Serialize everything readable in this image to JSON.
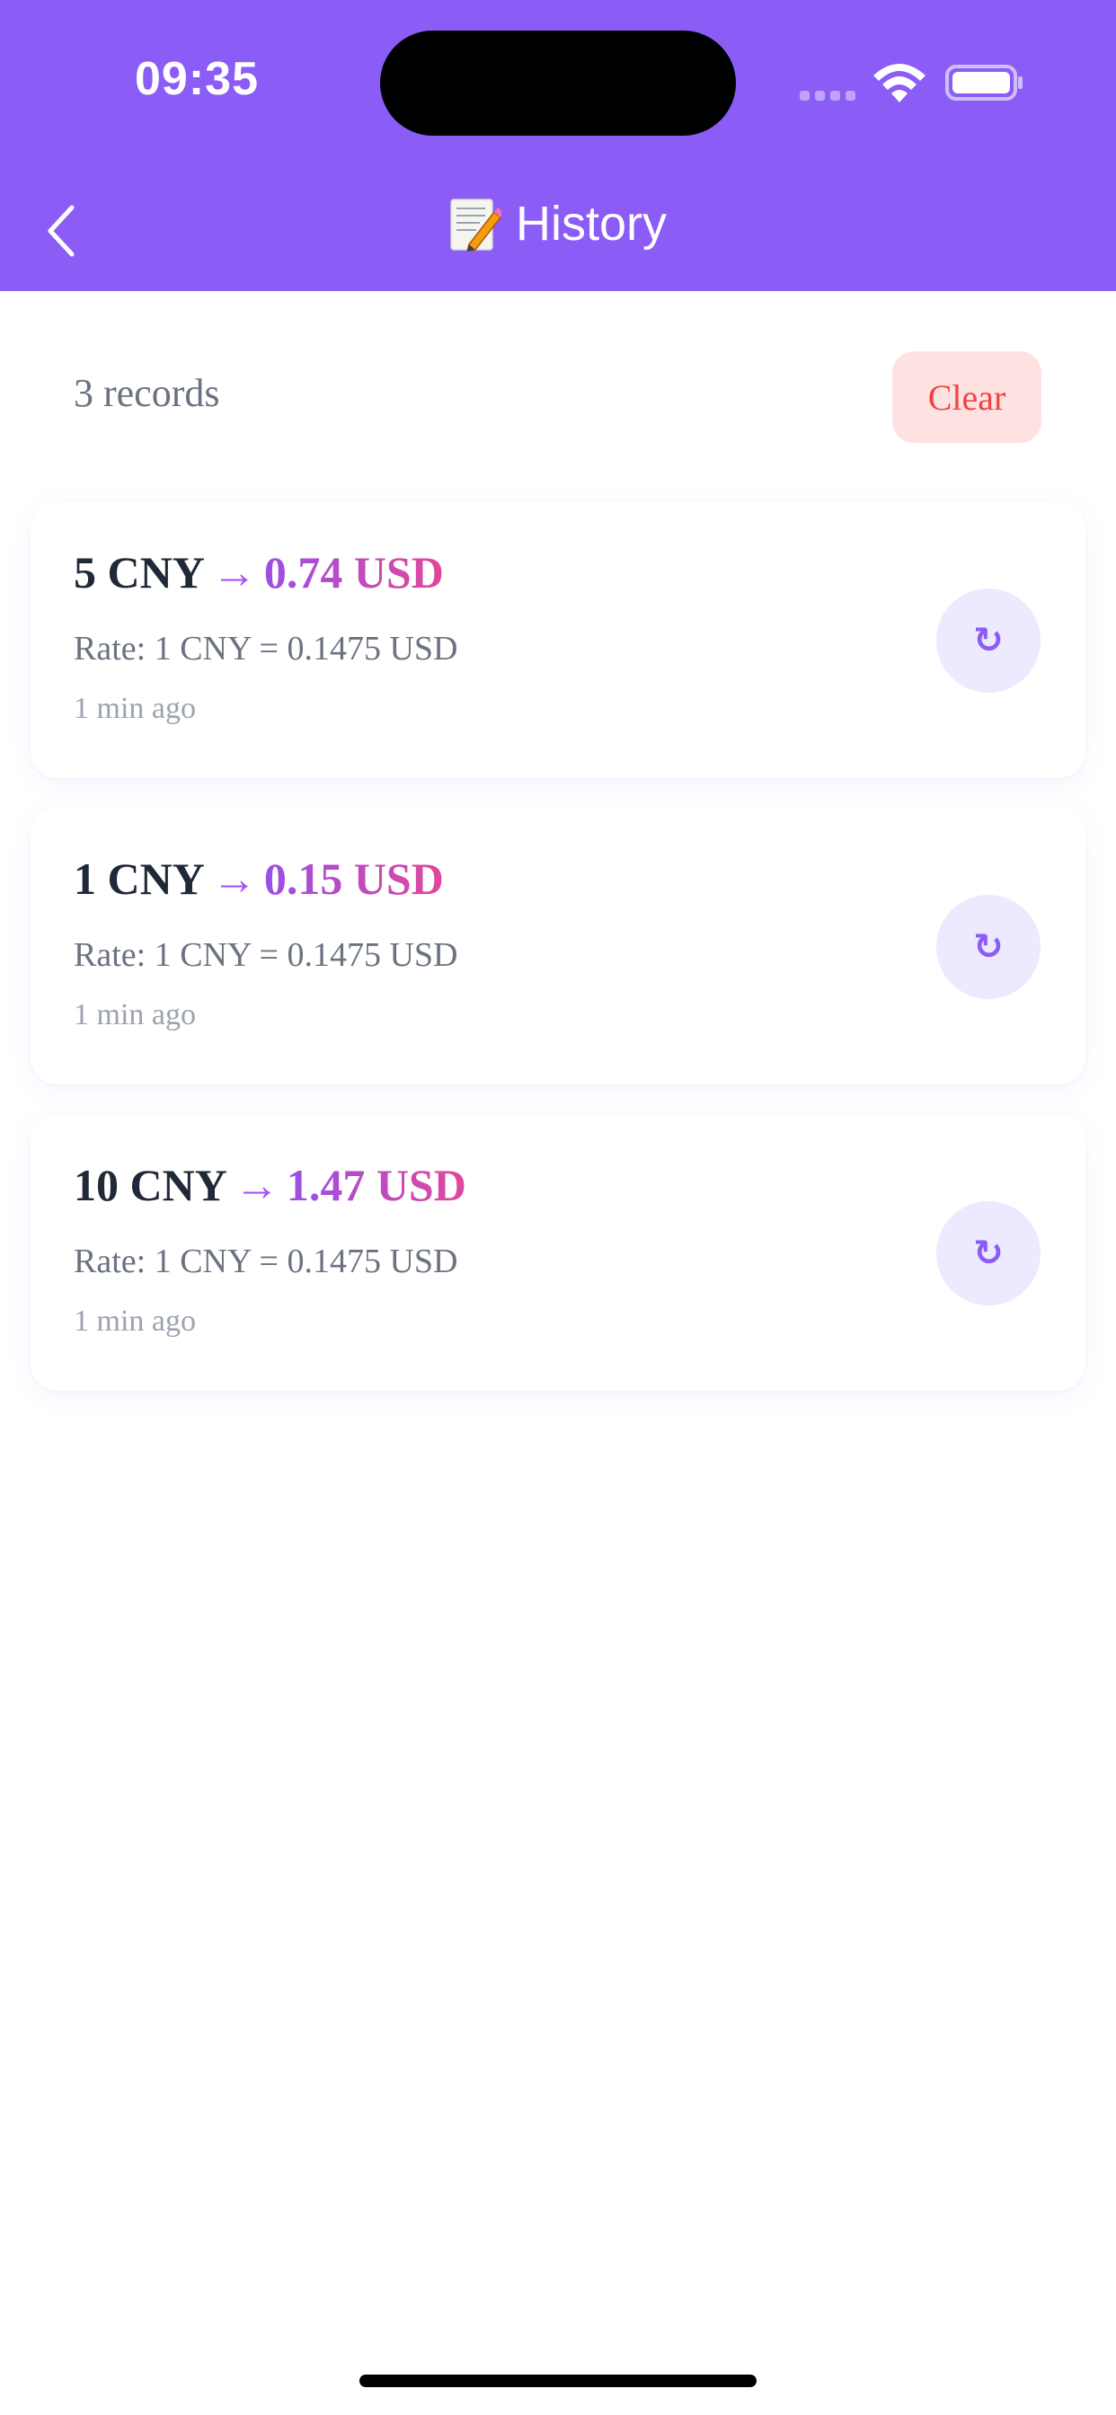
{
  "status_bar": {
    "time": "09:35",
    "icons": [
      "cellular-signal-icon",
      "wifi-icon",
      "battery-icon"
    ]
  },
  "nav": {
    "back_icon": "chevron-left-icon",
    "title_icon": "memo-icon",
    "title": "History"
  },
  "summary": {
    "records_label": "3 records",
    "clear_label": "Clear"
  },
  "records": [
    {
      "from": "5 CNY",
      "arrow": "→",
      "to": "0.74 USD",
      "rate": "Rate: 1 CNY = 0.1475 USD",
      "time": "1 min ago",
      "action_icon": "↻"
    },
    {
      "from": "1 CNY",
      "arrow": "→",
      "to": "0.15 USD",
      "rate": "Rate: 1 CNY = 0.1475 USD",
      "time": "1 min ago",
      "action_icon": "↻"
    },
    {
      "from": "10 CNY",
      "arrow": "→",
      "to": "1.47 USD",
      "rate": "Rate: 1 CNY = 0.1475 USD",
      "time": "1 min ago",
      "action_icon": "↻"
    }
  ],
  "colors": {
    "header": "#8b5cf6",
    "clear_bg": "#fee2e2",
    "clear_text": "#ef4444",
    "accent_purple": "#a855f7",
    "accent_pink": "#e0489a"
  }
}
